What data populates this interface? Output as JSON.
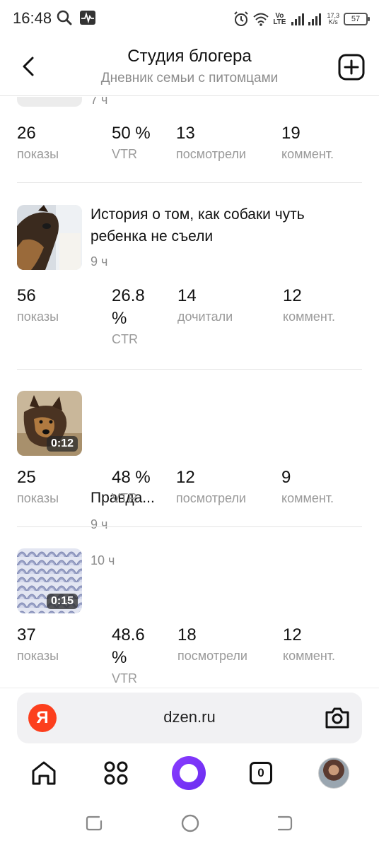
{
  "status_bar": {
    "time": "16:48",
    "icons": [
      "search-icon",
      "activity-icon",
      "alarm-icon",
      "wifi-icon",
      "signal-icon"
    ],
    "volte": "Vo",
    "lte": "LTE",
    "speed_value": "17,3",
    "speed_unit": "K/s",
    "battery": "57"
  },
  "header": {
    "title": "Студия блогера",
    "subtitle": "Дневник семьи с питомцами"
  },
  "partial_post": {
    "time": "7 ч",
    "stats": [
      {
        "value": "26",
        "label": "показы"
      },
      {
        "value": "50 %",
        "label": "VTR"
      },
      {
        "value": "13",
        "label": "посмотрели"
      },
      {
        "value": "19",
        "label": "коммент."
      }
    ]
  },
  "posts": [
    {
      "title": "История о том, как собаки чуть ребенка не съели",
      "time": "9 ч",
      "duration": "",
      "stats": [
        {
          "value": "56",
          "label": "показы"
        },
        {
          "value": "26.8 %",
          "label": "CTR"
        },
        {
          "value": "14",
          "label": "дочитали"
        },
        {
          "value": "12",
          "label": "коммент."
        }
      ]
    },
    {
      "title": "Правда...",
      "time": "9 ч",
      "duration": "0:12",
      "stats": [
        {
          "value": "25",
          "label": "показы"
        },
        {
          "value": "48 %",
          "label": "VTR"
        },
        {
          "value": "12",
          "label": "посмотрели"
        },
        {
          "value": "9",
          "label": "коммент."
        }
      ]
    },
    {
      "title": "",
      "time": "10 ч",
      "duration": "0:15",
      "stats": [
        {
          "value": "37",
          "label": "показы"
        },
        {
          "value": "48.6 %",
          "label": "VTR"
        },
        {
          "value": "18",
          "label": "посмотрели"
        },
        {
          "value": "12",
          "label": "коммент."
        }
      ]
    }
  ],
  "browser": {
    "logo": "Я",
    "url": "dzen.ru"
  },
  "bottom_nav": {
    "tabs_count": "0"
  },
  "colors": {
    "yandex_red": "#fc3f1d",
    "alice_purple": "#7b34ff",
    "muted_text": "#9a9a9a"
  }
}
